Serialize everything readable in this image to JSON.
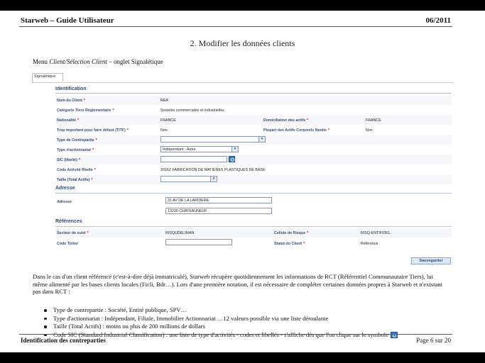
{
  "header": {
    "title": "Starweb – Guide Utilisateur",
    "date": "06/2011"
  },
  "section_title": "2.    Modifier les données clients",
  "menu_line": {
    "prefix": "Menu ",
    "path": "Client/Sélection Client",
    "suffix": " – onglet Signalétique"
  },
  "form": {
    "tab": "Signalétique",
    "identification": {
      "title": "Identification",
      "nom_client": {
        "label": "Nom du Client",
        "value": "REA"
      },
      "categorie": {
        "label": "Catégorie Tiers Réglementaire",
        "value": "Sociétés commerciales et industrielles"
      },
      "nationalite": {
        "label": "Nationalité",
        "value": "FRANCE"
      },
      "domiciliation": {
        "label": "Domiciliation des actifs",
        "value": "FRANCE"
      },
      "trop_important": {
        "label": "Trop important pour faire défaut (TITF)",
        "value": "Non"
      },
      "plupart_actifs": {
        "label": "Plupart des Actifs Corporels Nantis",
        "value": "Non"
      },
      "type_contrepartie": {
        "label": "Type de Contrepartie",
        "value": ""
      },
      "type_actionnariat": {
        "label": "Type d'actionnariat",
        "value": "Indépendant - Autre"
      },
      "sic": {
        "label": "SIC (libellé)",
        "value": ""
      },
      "code_activite": {
        "label": "Code Activité Réelle",
        "value": "2016Z FABRICATION DE MATIERES PLASTIQUES DE BASE"
      },
      "taille": {
        "label": "Taille (Total Actifs)",
        "value": ""
      }
    },
    "adresse": {
      "title": "Adresse",
      "label": "Adresse",
      "line1": "31 AV DE LA LARDIERE",
      "line2": "13220     CHATEAUNEUF"
    },
    "references": {
      "title": "Références",
      "secteur": {
        "label": "Secteur de suivi",
        "value": "RISQUDELIMAN"
      },
      "cellule": {
        "label": "Cellule de Risque",
        "value": "RISQ-ENTIFIDEL"
      },
      "code_ticker": {
        "label": "Code Ticker",
        "value": ""
      },
      "statut": {
        "label": "Statut du Client",
        "value": "Référencé"
      }
    },
    "save_label": "Sauvegarder"
  },
  "paragraph": "Dans le cas d'un client référencé (c'est-à-dire déjà immatriculé), Starweb récupère quotidiennement les informations de RCT (Référentiel Communautaire Tiers), lui même alimenté par les bases clients locales (Ficli, Bdr…). Lors d'une première notation, il est nécessaire de compléter certaines données propres à Starweb et n'existant pas dans RCT :",
  "bullets": [
    "Type de contrepartie : Société, Entité publique, SPV…",
    "Type d'actionnariat : Indépendant, Filiale, Immobilier Actionnariat …12 valeurs possible via une liste déroulante",
    "Taille (Total Actifs) : moins ou plus de 200 millions de dollars",
    "Code SIC (Standard Industrial Classification) : une liste de type d'activités - codes et libellés - s'affiche dès que l'on clique sur le symbole"
  ],
  "footer": {
    "left": "Identification des contreparties",
    "right": "Page 6 sur 20"
  }
}
